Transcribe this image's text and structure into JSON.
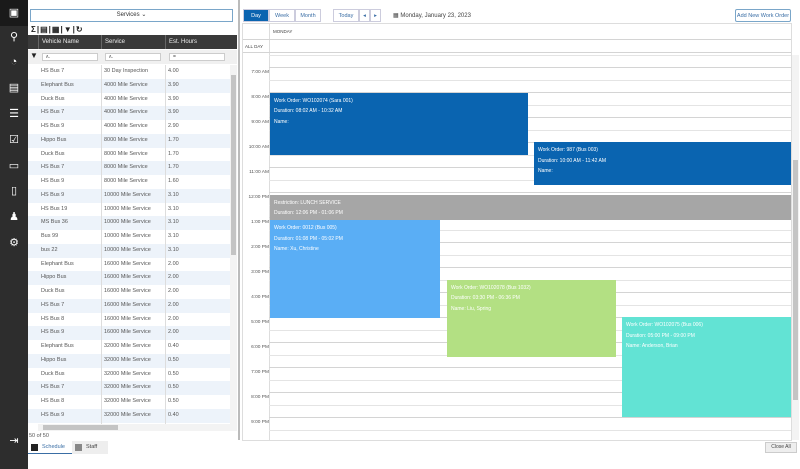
{
  "sidebar": {
    "icons": [
      "windows-icon",
      "search-icon",
      "dashboard-icon",
      "schedule-icon",
      "list-icon",
      "checklist-icon",
      "chat-icon",
      "document-icon",
      "alert-icon",
      "settings-icon"
    ],
    "logout_icon": "logout-icon"
  },
  "left": {
    "services_dropdown": "Services",
    "columns": [
      "Vehicle Name",
      "Service",
      "Est. Hours"
    ],
    "rows": [
      [
        "HS Bus 7",
        "30 Day Inspection",
        "4.00"
      ],
      [
        "Elephant Bus",
        "4000 Mile Service",
        "3.90"
      ],
      [
        "Duck Bus",
        "4000 Mile Service",
        "3.90"
      ],
      [
        "HS Bus 7",
        "4000 Mile Service",
        "3.90"
      ],
      [
        "HS Bus 9",
        "4000 Mile Service",
        "2.90"
      ],
      [
        "Hippo Bus",
        "8000 Mile Service",
        "1.70"
      ],
      [
        "Duck Bus",
        "8000 Mile Service",
        "1.70"
      ],
      [
        "HS Bus 7",
        "8000 Mile Service",
        "1.70"
      ],
      [
        "HS Bus 9",
        "8000 Mile Service",
        "1.60"
      ],
      [
        "HS Bus 9",
        "10000 Mile Service",
        "3.10"
      ],
      [
        "HS Bus 19",
        "10000 Mile Service",
        "3.10"
      ],
      [
        "MS Bus 36",
        "10000 Mile Service",
        "3.10"
      ],
      [
        "Bus 99",
        "10000 Mile Service",
        "3.10"
      ],
      [
        "bus 22",
        "10000 Mile Service",
        "3.10"
      ],
      [
        "Elephant Bus",
        "16000 Mile Service",
        "2.00"
      ],
      [
        "Hippo Bus",
        "16000 Mile Service",
        "2.00"
      ],
      [
        "Duck Bus",
        "16000 Mile Service",
        "2.00"
      ],
      [
        "HS Bus 7",
        "16000 Mile Service",
        "2.00"
      ],
      [
        "HS Bus 8",
        "16000 Mile Service",
        "2.00"
      ],
      [
        "HS Bus 9",
        "16000 Mile Service",
        "2.00"
      ],
      [
        "Elephant Bus",
        "32000 Mile Service",
        "0.40"
      ],
      [
        "Hippo Bus",
        "32000 Mile Service",
        "0.50"
      ],
      [
        "Duck Bus",
        "32000 Mile Service",
        "0.50"
      ],
      [
        "HS Bus 7",
        "32000 Mile Service",
        "0.50"
      ],
      [
        "HS Bus 8",
        "32000 Mile Service",
        "0.50"
      ],
      [
        "HS Bus 9",
        "32000 Mile Service",
        "0.40"
      ]
    ],
    "count": "50 of 50",
    "tabs": [
      "Schedule",
      "Staff"
    ]
  },
  "calendar": {
    "views": [
      "Day",
      "Week",
      "Month"
    ],
    "active_view": "Day",
    "today": "Today",
    "date": "Monday, January 23, 2023",
    "add_button": "Add New Work Order",
    "day_header": "MONDAY",
    "all_day": "ALL DAY",
    "hours": [
      "7:00 AM",
      "8:00 AM",
      "9:00 AM",
      "10:00 AM",
      "11:00 AM",
      "12:00 PM",
      "1:00 PM",
      "2:00 PM",
      "3:00 PM",
      "4:00 PM",
      "5:00 PM",
      "6:00 PM",
      "7:00 PM",
      "8:00 PM",
      "9:00 PM"
    ],
    "events": [
      {
        "title": "Work Order: WO102074 (Sara 001)",
        "duration": "Duration: 08:02 AM - 10:32 AM",
        "name": "Name:",
        "color": "#0a64b0"
      },
      {
        "title": "Work Order: 987 (Bus 003)",
        "duration": "Duration: 10:00 AM - 11:42 AM",
        "name": "Name:",
        "color": "#0a64b0"
      },
      {
        "title": "Restriction: LUNCH SERVICE",
        "duration": "Duration: 12:06 PM - 01:06 PM",
        "name": "",
        "color": "#a6a6a6"
      },
      {
        "title": "Work Order: 0012 (Bus 005)",
        "duration": "Duration: 01:08 PM - 05:02 PM",
        "name": "Name: Xu, Christine",
        "color": "#5aaef5"
      },
      {
        "title": "Work Order: WO102078 (Bus 1032)",
        "duration": "Duration: 03:30 PM - 06:36 PM",
        "name": "Name: Liu, Spring",
        "color": "#b3e083"
      },
      {
        "title": "Work Order: WO102075 (Bus 006)",
        "duration": "Duration: 05:00 PM - 09:00 PM",
        "name": "Name: Anderson, Brian",
        "color": "#62e3d4"
      }
    ],
    "close_all": "Close All"
  }
}
